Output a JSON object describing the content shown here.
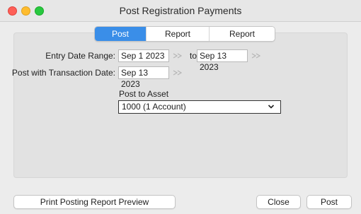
{
  "window": {
    "title": "Post Registration Payments"
  },
  "tabs": [
    {
      "label": "Post Options",
      "active": true
    },
    {
      "label": "Report Preview",
      "active": false
    },
    {
      "label": "Report Options",
      "active": false
    }
  ],
  "form": {
    "entry_date_label": "Entry Date Range:",
    "entry_date_from": "Sep 1 2023",
    "to_label": "to",
    "entry_date_to": "Sep 13 2023",
    "post_date_label": "Post with Transaction Date:",
    "post_date": "Sep 13 2023",
    "asset_label": "Post to Asset",
    "asset_selected": "1000 (1 Account)"
  },
  "buttons": {
    "print_preview": "Print Posting Report Preview",
    "close": "Close",
    "post": "Post"
  },
  "colors": {
    "active_tab": "#3a8ee8",
    "close_light": "#fe5f57",
    "minimize_light": "#febc2e",
    "zoom_light": "#28c840"
  },
  "icons": {
    "calendar": "calendar-icon",
    "dropdown": "chevron-down-icon"
  }
}
